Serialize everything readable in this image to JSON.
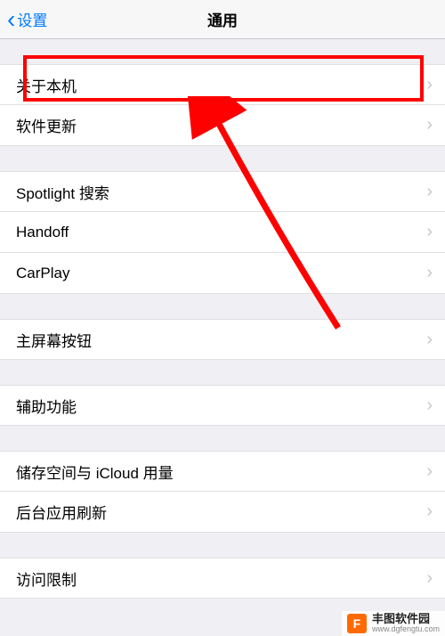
{
  "header": {
    "back_label": "设置",
    "title": "通用"
  },
  "groups": [
    {
      "items": [
        {
          "label": "关于本机"
        },
        {
          "label": "软件更新"
        }
      ]
    },
    {
      "items": [
        {
          "label": "Spotlight 搜索"
        },
        {
          "label": "Handoff"
        },
        {
          "label": "CarPlay"
        }
      ]
    },
    {
      "items": [
        {
          "label": "主屏幕按钮"
        }
      ]
    },
    {
      "items": [
        {
          "label": "辅助功能"
        }
      ]
    },
    {
      "items": [
        {
          "label": "储存空间与 iCloud 用量"
        },
        {
          "label": "后台应用刷新"
        }
      ]
    },
    {
      "items": [
        {
          "label": "访问限制"
        }
      ]
    }
  ],
  "watermark": {
    "logo": "F",
    "main": "丰图软件园",
    "sub": "www.dgfengtu.com"
  }
}
